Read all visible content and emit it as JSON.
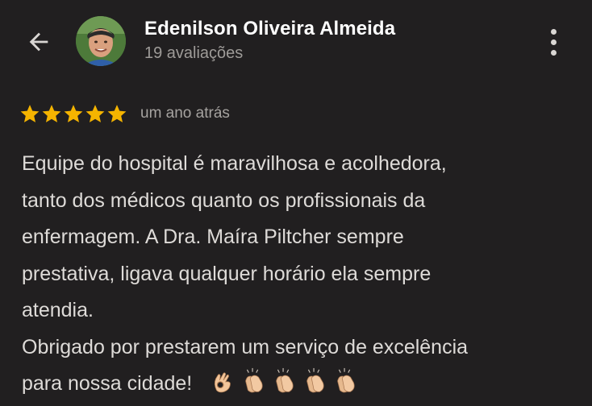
{
  "header": {
    "reviewer_name": "Edenilson Oliveira Almeida",
    "review_count": "19 avaliações",
    "back_icon": "arrow-left-icon",
    "more_icon": "more-vert-icon"
  },
  "review": {
    "rating": 5,
    "max_rating": 5,
    "star_color": "#f5b400",
    "time": "um ano atrás",
    "lines": [
      "Equipe do hospital é maravilhosa e acolhedora,",
      "tanto dos médicos quanto os profissionais da",
      "enfermagem. A Dra. Maíra Piltcher sempre",
      "prestativa, ligava qualquer horário ela sempre",
      "atendia.",
      "Obrigado por prestarem um serviço de excelência",
      "para nossa cidade!"
    ],
    "emojis": [
      "ok-hand-icon",
      "clapping-hands-icon",
      "clapping-hands-icon",
      "clapping-hands-icon",
      "clapping-hands-icon"
    ]
  },
  "colors": {
    "background": "#211f20",
    "text_primary": "#ffffff",
    "text_secondary": "#9e9b98",
    "body_text": "#dedbd8"
  }
}
